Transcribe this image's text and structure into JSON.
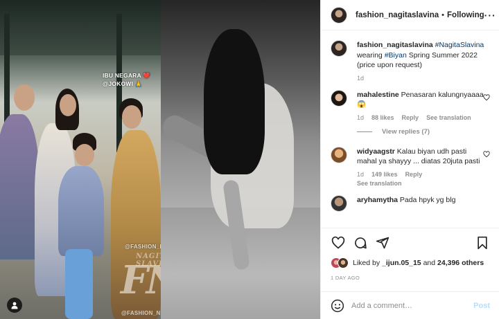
{
  "post": {
    "left_image": {
      "story_caption_line1": "IBU NEGARA ❤️",
      "story_caption_line2": "@JOKOWI 🙏",
      "watermark": "@FASHION_NAGITASLAVINA",
      "watermark_name": "NAGITA SLAVINA",
      "watermark_logo": "FNS",
      "watermark_bottom": "@FASHION_NAGITASLAVINA",
      "tag_icon": "user-icon"
    }
  },
  "header": {
    "username": "fashion_nagitaslavina",
    "separator": "•",
    "follow_status": "Following",
    "more_icon": "more-horizontal-icon"
  },
  "caption": {
    "username": "fashion_nagitaslavina",
    "hashtag1": "#NagitaSlavina",
    "text_mid": "wearing",
    "hashtag2": "#Biyan",
    "text_end": "Spring Summer 2022 (price upon request)",
    "time": "1d"
  },
  "comments": [
    {
      "username": "mahalestine",
      "text": "Penasaran kalungnyaaaa😱",
      "time": "1d",
      "likes": "88 likes",
      "reply": "Reply",
      "translate": "See translation",
      "view_replies": "View replies (7)"
    },
    {
      "username": "widyaagstr",
      "text": "Kalau biyan udh pasti mahal ya shayyy ... diatas 20juta pasti",
      "time": "1d",
      "likes": "149 likes",
      "reply": "Reply",
      "translate": "See translation"
    },
    {
      "username": "aryhamytha",
      "text": "Pada hpyk yg blg"
    }
  ],
  "actions": {
    "like_icon": "heart-icon",
    "comment_icon": "comment-icon",
    "share_icon": "share-icon",
    "save_icon": "bookmark-icon"
  },
  "likes": {
    "prefix": "Liked by",
    "user": "_ijun.05_15",
    "middle": "and",
    "count": "24,396 others"
  },
  "date": "1 DAY AGO",
  "composer": {
    "emoji_icon": "emoji-icon",
    "placeholder": "Add a comment…",
    "post_label": "Post"
  },
  "colors": {
    "link": "#00376b",
    "secondary": "#8e8e8e",
    "post_disabled": "#b2dffc"
  }
}
